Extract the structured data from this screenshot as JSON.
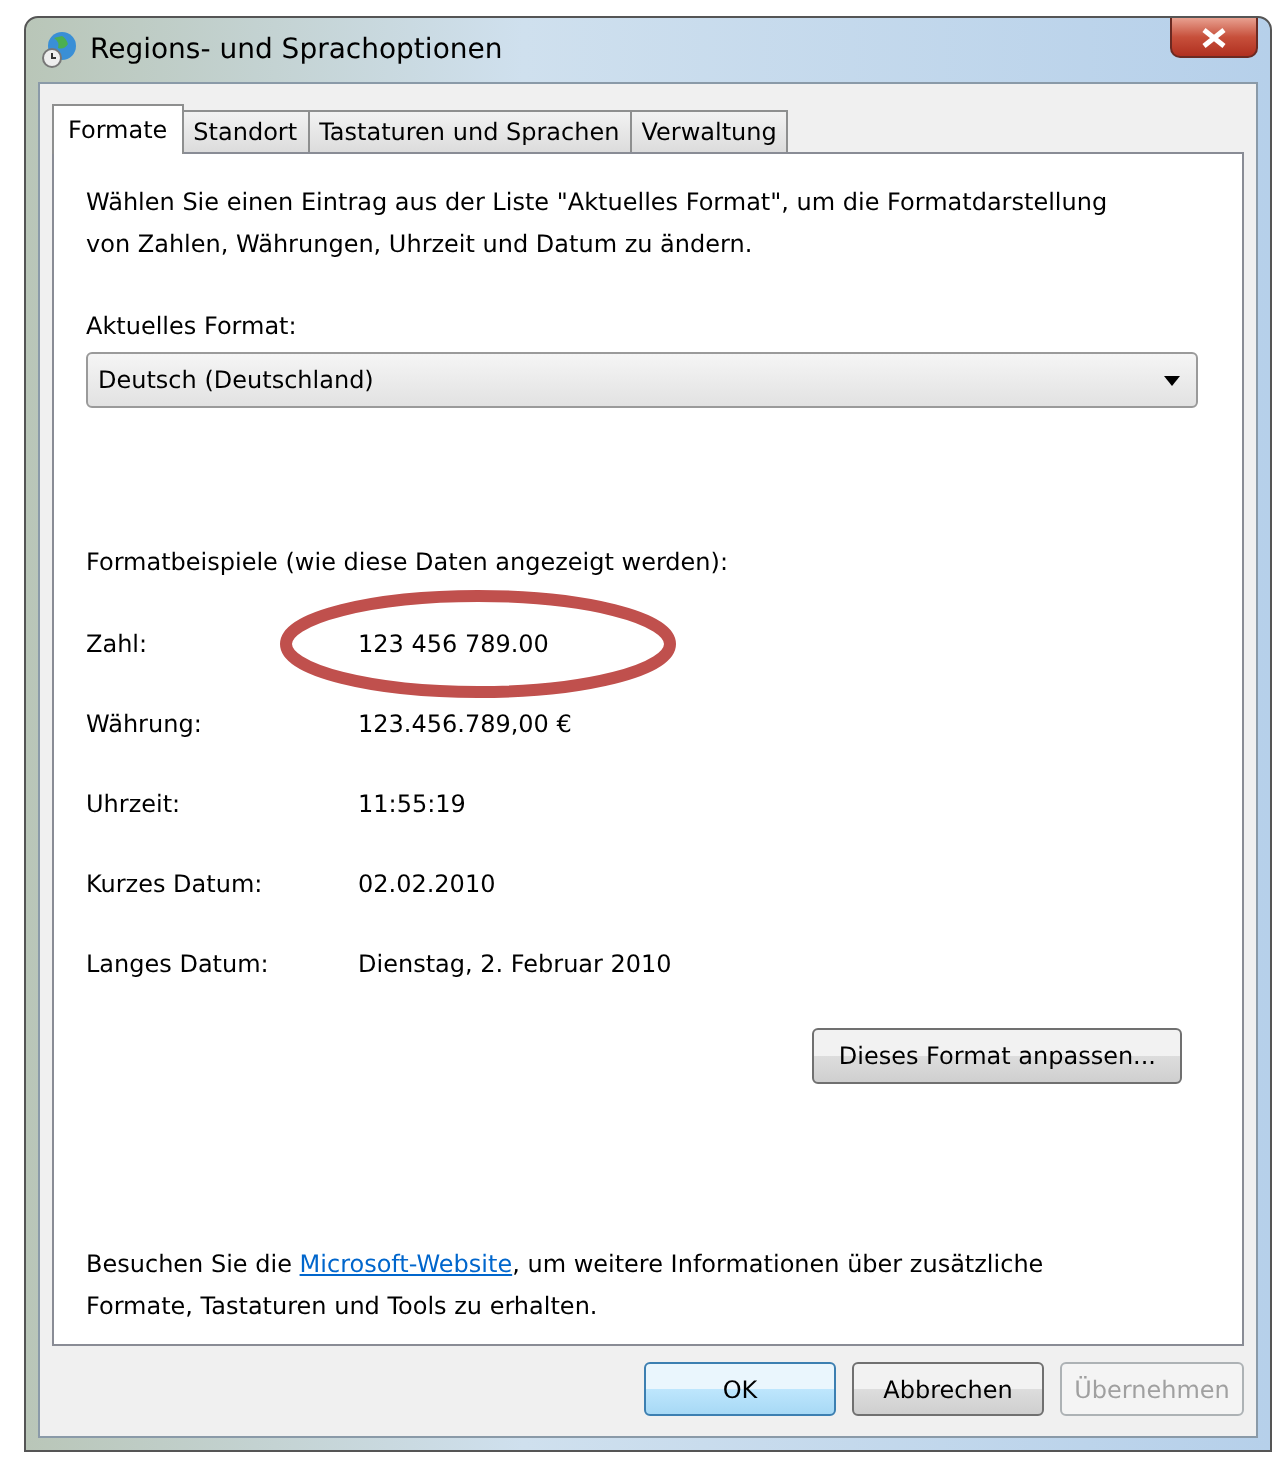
{
  "window": {
    "title": "Regions- und Sprachoptionen"
  },
  "tabs": [
    {
      "label": "Formate",
      "selected": true
    },
    {
      "label": "Standort",
      "selected": false
    },
    {
      "label": "Tastaturen und Sprachen",
      "selected": false
    },
    {
      "label": "Verwaltung",
      "selected": false
    }
  ],
  "intro": "Wählen Sie einen Eintrag aus der Liste \"Aktuelles Format\", um die Formatdarstellung von Zahlen, Währungen, Uhrzeit und Datum zu ändern.",
  "current_format": {
    "label": "Aktuelles Format:",
    "value": "Deutsch (Deutschland)"
  },
  "examples": {
    "heading": "Formatbeispiele (wie diese Daten angezeigt werden):",
    "rows": [
      {
        "label": "Zahl:",
        "value": "123 456 789.00"
      },
      {
        "label": "Währung:",
        "value": "123.456.789,00 €"
      },
      {
        "label": "Uhrzeit:",
        "value": "11:55:19"
      },
      {
        "label": "Kurzes Datum:",
        "value": "02.02.2010"
      },
      {
        "label": "Langes Datum:",
        "value": "Dienstag, 2. Februar 2010"
      }
    ]
  },
  "annotation": {
    "kind": "ellipse",
    "color": "#c0504d"
  },
  "customize_button": "Dieses Format anpassen...",
  "footer": {
    "before": "Besuchen Sie die ",
    "link": "Microsoft-Website",
    "after": ", um weitere Informationen über zusätzliche Formate, Tastaturen und Tools zu erhalten."
  },
  "buttons": [
    {
      "label": "OK",
      "default": true,
      "disabled": false
    },
    {
      "label": "Abbrechen",
      "default": false,
      "disabled": false
    },
    {
      "label": "Übernehmen",
      "default": false,
      "disabled": true
    }
  ]
}
